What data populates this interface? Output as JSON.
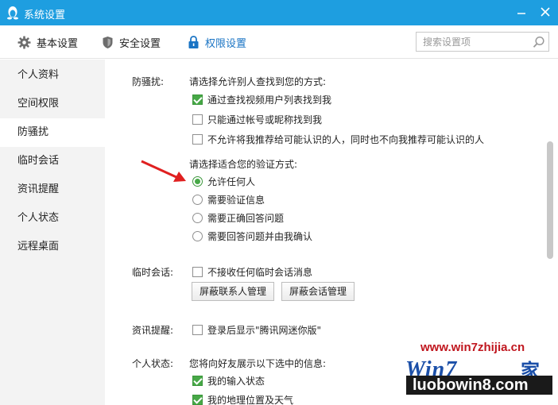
{
  "window": {
    "title": "系统设置"
  },
  "toolbar": {
    "tabs": [
      {
        "label": "基本设置",
        "icon": "gear-icon"
      },
      {
        "label": "安全设置",
        "icon": "shield-icon"
      },
      {
        "label": "权限设置",
        "icon": "lock-icon"
      }
    ],
    "search_placeholder": "搜索设置项"
  },
  "sidebar": {
    "items": [
      {
        "label": "个人资料"
      },
      {
        "label": "空间权限"
      },
      {
        "label": "防骚扰"
      },
      {
        "label": "临时会话"
      },
      {
        "label": "资讯提醒"
      },
      {
        "label": "个人状态"
      },
      {
        "label": "远程桌面"
      }
    ],
    "selected": "防骚扰"
  },
  "content": {
    "harassment": {
      "label": "防骚扰:",
      "find_prompt": "请选择允许别人查找到您的方式:",
      "find_options": [
        {
          "label": "通过查找视频用户列表找到我",
          "checked": true
        },
        {
          "label": "只能通过帐号或昵称找到我",
          "checked": false
        },
        {
          "label": "不允许将我推荐给可能认识的人，同时也不向我推荐可能认识的人",
          "checked": false
        }
      ],
      "verify_prompt": "请选择适合您的验证方式:",
      "verify_options": [
        {
          "label": "允许任何人",
          "selected": true
        },
        {
          "label": "需要验证信息",
          "selected": false
        },
        {
          "label": "需要正确回答问题",
          "selected": false
        },
        {
          "label": "需要回答问题并由我确认",
          "selected": false
        }
      ]
    },
    "temp_session": {
      "label": "临时会话:",
      "option": {
        "label": "不接收任何临时会话消息",
        "checked": false
      },
      "buttons": [
        "屏蔽联系人管理",
        "屏蔽会话管理"
      ]
    },
    "news": {
      "label": "资讯提醒:",
      "option": {
        "label": "登录后显示\"腾讯网迷你版\"",
        "checked": false
      }
    },
    "status": {
      "label": "个人状态:",
      "prompt": "您将向好友展示以下选中的信息:",
      "options": [
        {
          "label": "我的输入状态",
          "checked": true
        },
        {
          "label": "我的地理位置及天气",
          "checked": true
        }
      ]
    }
  },
  "watermark": {
    "site": "www.win7zhijia.cn",
    "logo": "Win7",
    "logo_suffix": "家",
    "band": "luobowin8.com"
  },
  "colors": {
    "titlebar": "#1e9ee0",
    "active_tab": "#1a74c4",
    "check_green": "#47a847",
    "arrow_red": "#e02020",
    "sidebar_bg": "#f3f3f3"
  }
}
